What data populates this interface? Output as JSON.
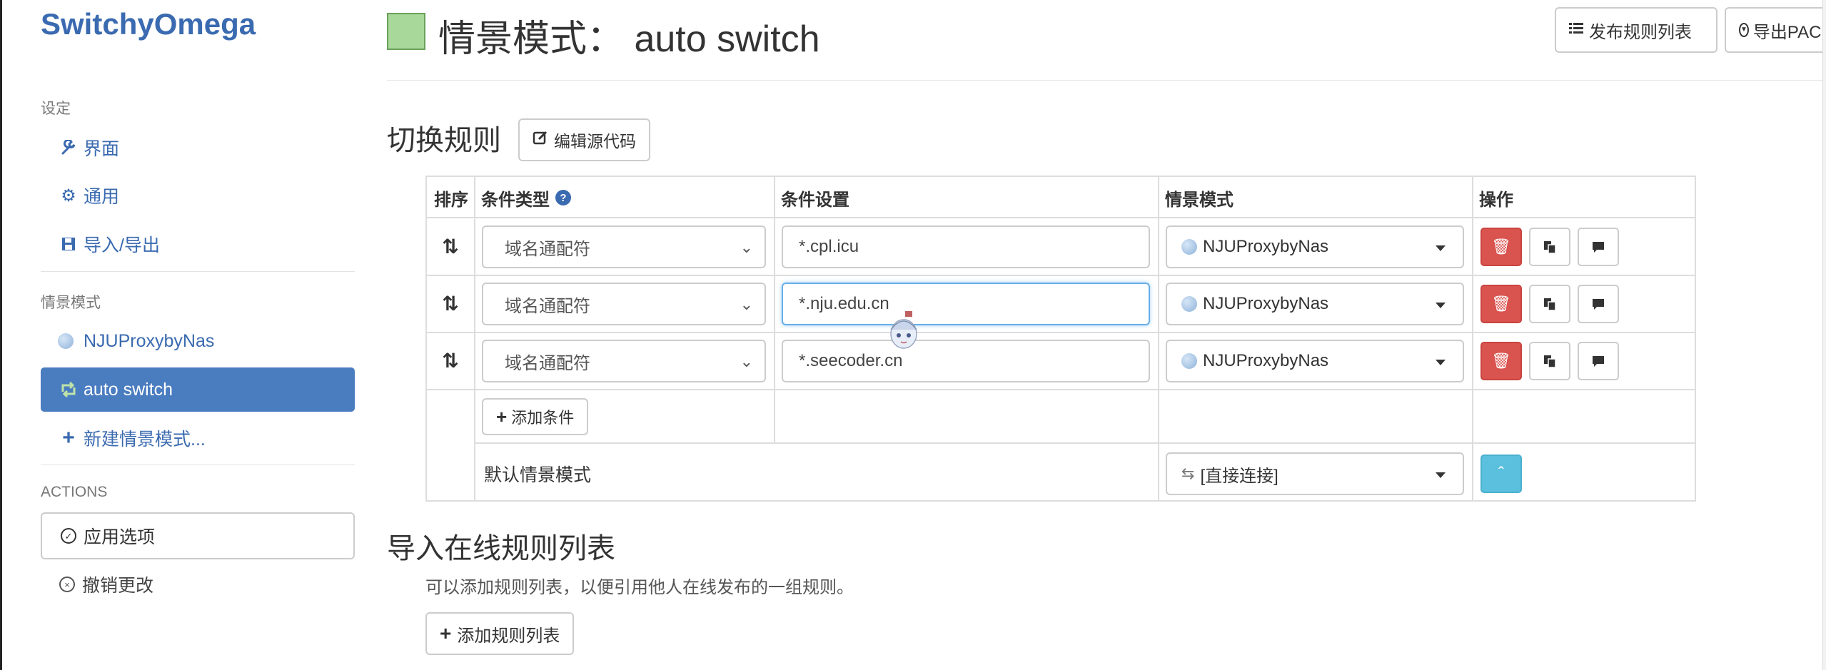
{
  "sidebar": {
    "brand": "SwitchyOmega",
    "settings_header": "设定",
    "settings_items": [
      {
        "label": "界面",
        "icon": "wrench-icon"
      },
      {
        "label": "通用",
        "icon": "gear-icon"
      },
      {
        "label": "导入/导出",
        "icon": "save-icon"
      }
    ],
    "profiles_header": "情景模式",
    "profiles": [
      {
        "label": "NJUProxybyNas",
        "icon": "globe-icon"
      },
      {
        "label": "auto switch",
        "icon": "retweet-icon",
        "active": true
      }
    ],
    "new_profile_label": "新建情景模式...",
    "actions_header": "ACTIONS",
    "apply_label": "应用选项",
    "revert_label": "撤销更改"
  },
  "header": {
    "title": "情景模式：  auto switch",
    "swatch_color": "#a8d89a",
    "publish_label": "发布规则列表",
    "export_pac_label": "导出PAC"
  },
  "rules_section": {
    "title": "切换规则",
    "edit_source_label": "编辑源代码",
    "columns": [
      "排序",
      "条件类型",
      "条件设置",
      "情景模式",
      "操作"
    ],
    "rows": [
      {
        "condition_type": "域名通配符",
        "condition": "*.cpl.icu",
        "profile": "NJUProxybyNas"
      },
      {
        "condition_type": "域名通配符",
        "condition": "*.nju.edu.cn",
        "profile": "NJUProxybyNas",
        "focused": true
      },
      {
        "condition_type": "域名通配符",
        "condition": "*.seecoder.cn",
        "profile": "NJUProxybyNas"
      }
    ],
    "add_condition_label": "添加条件",
    "default_profile_label": "默认情景模式",
    "default_profile_value": "[直接连接]"
  },
  "online_section": {
    "title": "导入在线规则列表",
    "help_text": "可以添加规则列表，以便引用他人在线发布的一组规则。",
    "add_rule_list_label": "添加规则列表"
  },
  "colors": {
    "brand": "#3a6ab0",
    "active_nav": "#4a7cc0",
    "delete_button": "#d9534f",
    "info_button": "#5bc0de"
  }
}
